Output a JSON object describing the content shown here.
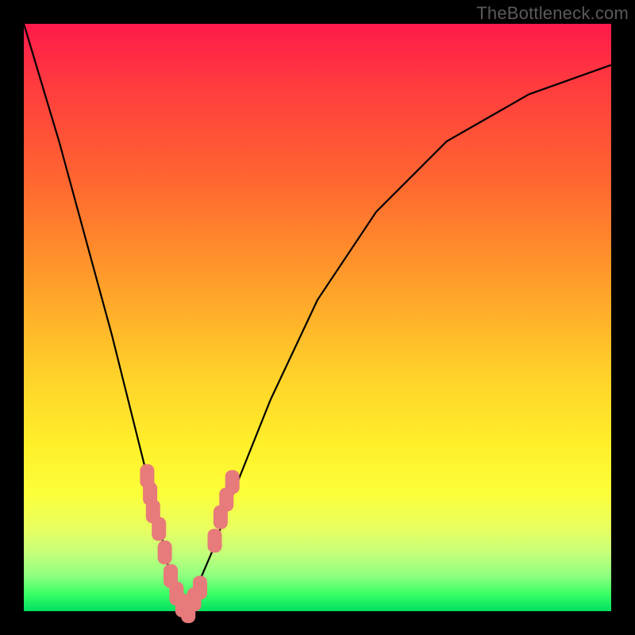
{
  "watermark": "TheBottleneck.com",
  "colors": {
    "frame": "#000000",
    "curve": "#000000",
    "marker": "#e77a7a",
    "gradient_top": "#ff1a4b",
    "gradient_bottom": "#00e060"
  },
  "chart_data": {
    "type": "line",
    "title": "",
    "xlabel": "",
    "ylabel": "",
    "xlim": [
      0,
      100
    ],
    "ylim": [
      0,
      100
    ],
    "series": [
      {
        "name": "bottleneck-curve",
        "x": [
          0,
          3,
          6,
          9,
          12,
          15,
          17,
          19,
          21,
          23,
          24.5,
          26,
          27.5,
          29,
          32,
          36,
          42,
          50,
          60,
          72,
          86,
          100
        ],
        "y": [
          100,
          90,
          80,
          69,
          58,
          47,
          39,
          31,
          23,
          15,
          8,
          3,
          0,
          3,
          10,
          21,
          36,
          53,
          68,
          80,
          88,
          93
        ]
      }
    ],
    "markers": {
      "name": "highlighted-points",
      "shape": "rounded-rect",
      "color": "#e77a7a",
      "points": [
        {
          "x": 21.0,
          "y": 23
        },
        {
          "x": 21.5,
          "y": 20
        },
        {
          "x": 22.0,
          "y": 17
        },
        {
          "x": 23.0,
          "y": 14
        },
        {
          "x": 24.0,
          "y": 10
        },
        {
          "x": 25.0,
          "y": 6
        },
        {
          "x": 26.0,
          "y": 3
        },
        {
          "x": 27.0,
          "y": 1
        },
        {
          "x": 28.0,
          "y": 0
        },
        {
          "x": 29.0,
          "y": 2
        },
        {
          "x": 30.0,
          "y": 4
        },
        {
          "x": 32.5,
          "y": 12
        },
        {
          "x": 33.5,
          "y": 16
        },
        {
          "x": 34.5,
          "y": 19
        },
        {
          "x": 35.5,
          "y": 22
        }
      ]
    }
  }
}
